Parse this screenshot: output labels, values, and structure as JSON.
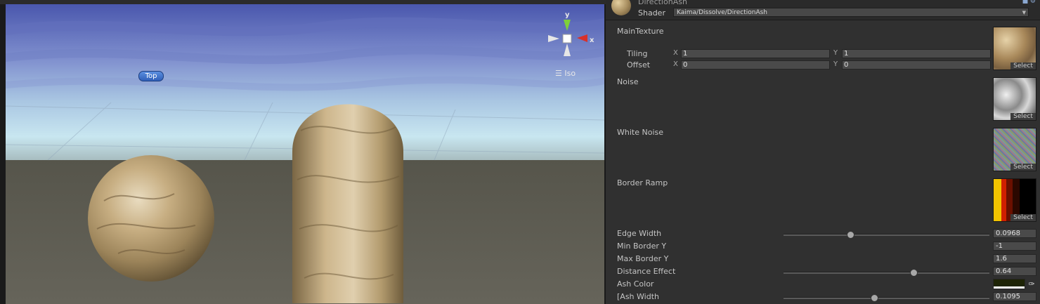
{
  "scene": {
    "view_label": "Top",
    "projection_label": "Iso",
    "gizmo": {
      "y_label": "y",
      "x_label": "x"
    },
    "colors": {
      "sky_top": "#4c5ab0",
      "sky_mid": "#8a9ad0",
      "horizon": "#b8dcec",
      "ground": "#5e5c50"
    }
  },
  "inspector": {
    "material_name": "DirectionAsh",
    "shader_label": "Shader",
    "shader_value": "Kaima/Dissolve/DirectionAsh",
    "properties": {
      "main_texture": {
        "label": "MainTexture",
        "tiling_label": "Tiling",
        "offset_label": "Offset",
        "x_label": "X",
        "y_label": "Y",
        "tiling_x": "1",
        "tiling_y": "1",
        "offset_x": "0",
        "offset_y": "0",
        "select_label": "Select"
      },
      "noise": {
        "label": "Noise",
        "select_label": "Select"
      },
      "white_noise": {
        "label": "White Noise",
        "select_label": "Select"
      },
      "border_ramp": {
        "label": "Border Ramp",
        "select_label": "Select"
      },
      "edge_width": {
        "label": "Edge Width",
        "value": "0.0968",
        "slider_fraction": 0.32
      },
      "min_border_y": {
        "label": "Min Border Y",
        "value": "-1"
      },
      "max_border_y": {
        "label": "Max Border Y",
        "value": "1.6"
      },
      "distance_effect": {
        "label": "Distance Effect",
        "value": "0.64",
        "slider_fraction": 0.64
      },
      "ash_color": {
        "label": "Ash Color",
        "color": "#1e2406"
      },
      "ash_width": {
        "label": "[Ash Width",
        "value": "0.1095",
        "slider_fraction": 0.44
      }
    }
  }
}
